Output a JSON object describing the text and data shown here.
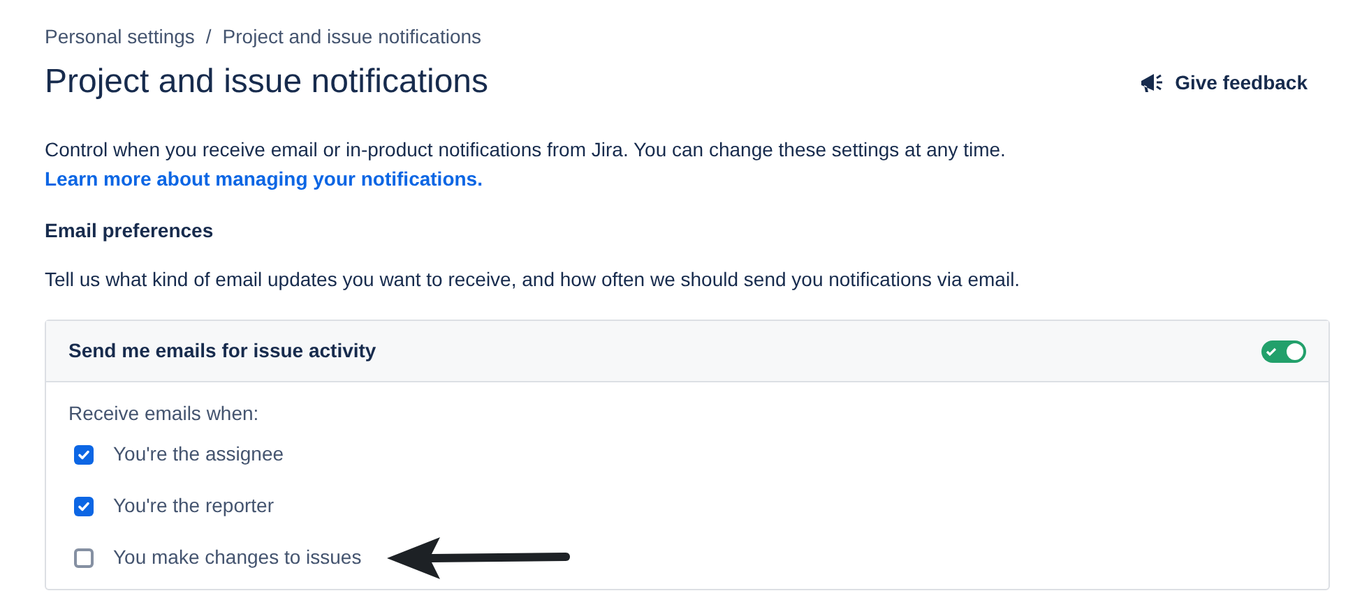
{
  "breadcrumbs": [
    "Personal settings",
    "Project and issue notifications"
  ],
  "breadcrumb_separator": "/",
  "title": "Project and issue notifications",
  "feedback_button": "Give feedback",
  "description": "Control when you receive email or in-product notifications from Jira. You can change these settings at any time.",
  "learn_more_link": "Learn more about managing your notifications.",
  "section_heading": "Email preferences",
  "section_description": "Tell us what kind of email updates you want to receive, and how often we should send you notifications via email.",
  "card": {
    "title": "Send me emails for issue activity",
    "toggle_on": true,
    "options_label": "Receive emails when:",
    "options": [
      {
        "label": "You're the assignee",
        "checked": true
      },
      {
        "label": "You're the reporter",
        "checked": true
      },
      {
        "label": "You make changes to issues",
        "checked": false,
        "annotated": true
      }
    ]
  }
}
